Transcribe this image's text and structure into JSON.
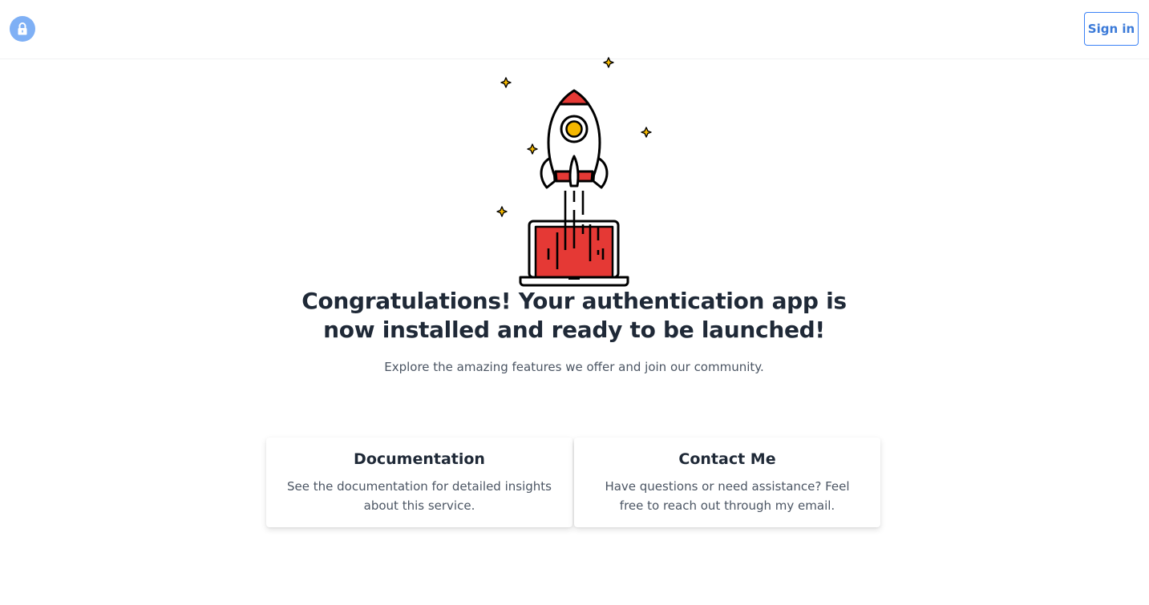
{
  "header": {
    "logo_icon": "lock-icon",
    "signin_label": "Sign in"
  },
  "hero": {
    "illustration": "rocket-launch-from-laptop",
    "headline": "Congratulations! Your authentication app is now installed and ready to be launched!",
    "subline": "Explore the amazing features we offer and join our community."
  },
  "cards": [
    {
      "title": "Documentation",
      "text": "See the documentation for detailed insights about this service."
    },
    {
      "title": "Contact Me",
      "text": "Have questions or need assistance? Feel free to reach out through my email."
    }
  ],
  "colors": {
    "accent": "#3b82f6",
    "logo_bg": "#7fb0f5",
    "rocket_red": "#e53935",
    "star_yellow": "#f5b800"
  }
}
